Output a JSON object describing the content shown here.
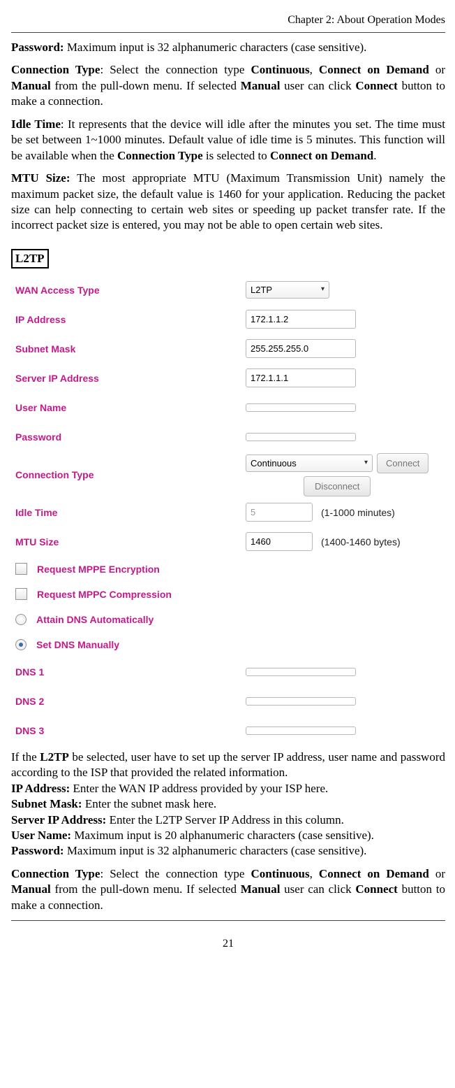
{
  "header": "Chapter 2: About Operation Modes",
  "p_password_top": {
    "b": "Password:",
    "t": " Maximum input is 32 alphanumeric characters (case sensitive)."
  },
  "p_conntype_top": {
    "parts": [
      {
        "b": "Connection Type"
      },
      {
        "t": ": Select the connection type "
      },
      {
        "b": "Continuous"
      },
      {
        "t": ", "
      },
      {
        "b": "Connect on Demand"
      },
      {
        "t": " or "
      },
      {
        "b": "Manual"
      },
      {
        "t": " from the pull-down menu. If selected "
      },
      {
        "b": "Manual"
      },
      {
        "t": " user can click "
      },
      {
        "b": "Connect"
      },
      {
        "t": " button to make a connection."
      }
    ]
  },
  "p_idle": {
    "parts": [
      {
        "b": "Idle Time"
      },
      {
        "t": ": It represents that the device will idle after the minutes you set. The time must be set between 1~1000 minutes. Default value of idle time is 5 minutes. This function will be available when the "
      },
      {
        "b": "Connection Type"
      },
      {
        "t": " is selected to "
      },
      {
        "b": "Connect on Demand"
      },
      {
        "t": "."
      }
    ]
  },
  "p_mtu": {
    "parts": [
      {
        "b": "MTU Size:"
      },
      {
        "t": " The most appropriate MTU (Maximum Transmission Unit) namely the maximum packet size, the default value is 1460 for your application. Reducing the packet size can help connecting to certain web sites or speeding up packet transfer rate. If the incorrect packet size is entered, you may not be able to open certain web sites."
      }
    ]
  },
  "section_label": "L2TP",
  "shot": {
    "wan_label": "WAN Access Type",
    "wan_value": "L2TP",
    "ip_label": "IP Address",
    "ip_value": "172.1.1.2",
    "mask_label": "Subnet Mask",
    "mask_value": "255.255.255.0",
    "server_label": "Server IP Address",
    "server_value": "172.1.1.1",
    "user_label": "User Name",
    "user_value": "",
    "pass_label": "Password",
    "pass_value": "",
    "conn_label": "Connection Type",
    "conn_value": "Continuous",
    "btn_connect": "Connect",
    "btn_disconnect": "Disconnect",
    "idle_label": "Idle Time",
    "idle_value": "5",
    "idle_hint": "(1-1000 minutes)",
    "mtu_label": "MTU Size",
    "mtu_value": "1460",
    "mtu_hint": "(1400-1460 bytes)",
    "opt_mppe": "Request MPPE Encryption",
    "opt_mppc": "Request MPPC Compression",
    "opt_dns_auto": "Attain DNS Automatically",
    "opt_dns_manual": "Set DNS Manually",
    "dns1_label": "DNS 1",
    "dns2_label": "DNS 2",
    "dns3_label": "DNS 3"
  },
  "p_l2tp_desc": {
    "parts": [
      {
        "t": "If the "
      },
      {
        "b": "L2TP"
      },
      {
        "t": " be selected, user have to set up the server IP address, user name and password according to the ISP that provided the related information."
      }
    ]
  },
  "p_ipaddr": {
    "b": "IP Address:",
    "t": " Enter the WAN IP address provided by your ISP here."
  },
  "p_subnet": {
    "b": "Subnet Mask:",
    "t": " Enter the subnet mask here."
  },
  "p_server": {
    "b": "Server IP Address:",
    "t": " Enter the L2TP Server IP Address in this column."
  },
  "p_user": {
    "b": "User Name:",
    "t": " Maximum input is 20 alphanumeric characters (case sensitive)."
  },
  "p_pass_bot": {
    "b": "Password:",
    "t": " Maximum input is 32 alphanumeric characters (case sensitive)."
  },
  "p_conntype_bot": {
    "parts": [
      {
        "b": "Connection Type"
      },
      {
        "t": ": Select the connection type "
      },
      {
        "b": "Continuous"
      },
      {
        "t": ", "
      },
      {
        "b": "Connect on Demand"
      },
      {
        "t": " or "
      },
      {
        "b": "Manual"
      },
      {
        "t": " from the pull-down menu. If selected "
      },
      {
        "b": "Manual"
      },
      {
        "t": " user can click "
      },
      {
        "b": "Connect"
      },
      {
        "t": " button to make a connection."
      }
    ]
  },
  "page_number": "21"
}
